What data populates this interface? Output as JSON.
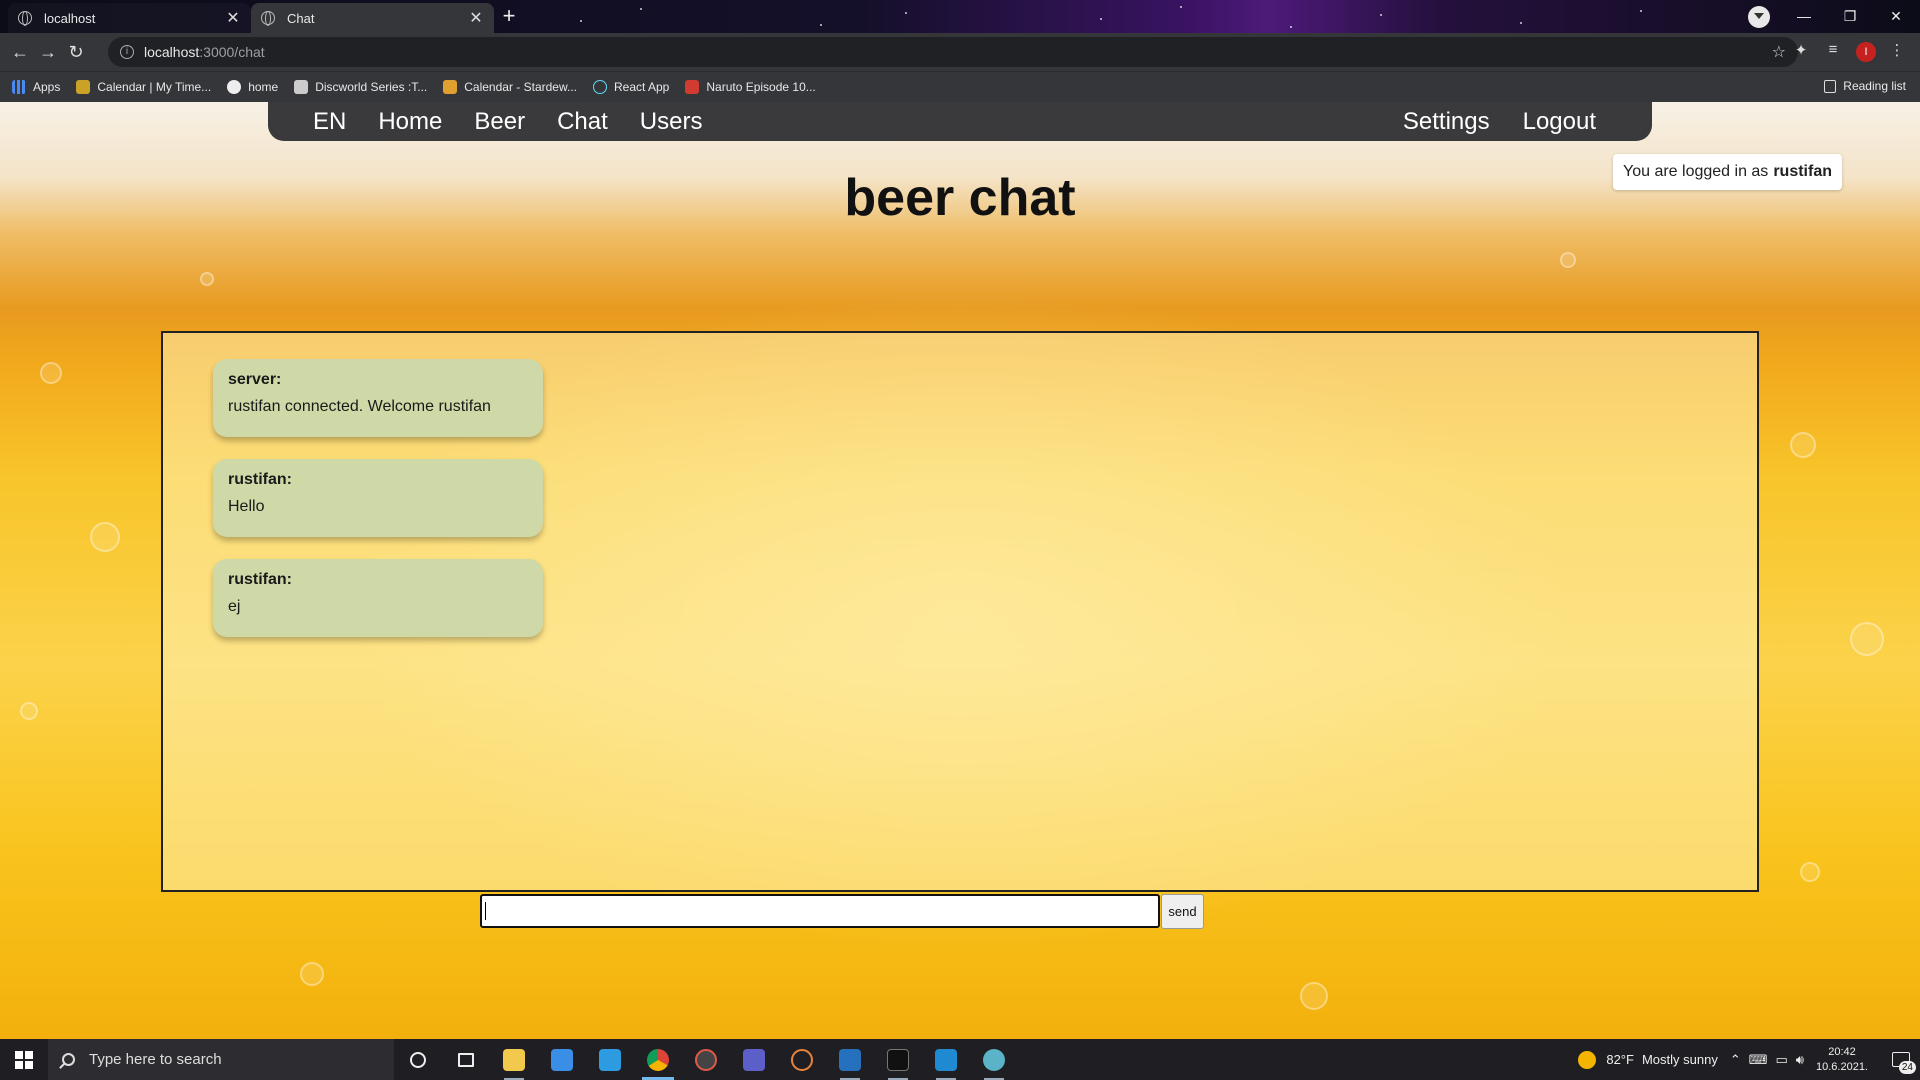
{
  "browser": {
    "tabs": [
      {
        "title": "localhost"
      },
      {
        "title": "Chat"
      }
    ],
    "url_host": "localhost",
    "url_path": ":3000/chat",
    "bookmarks": [
      {
        "label": "Apps"
      },
      {
        "label": "Calendar | My Time..."
      },
      {
        "label": "home"
      },
      {
        "label": "Discworld Series :T..."
      },
      {
        "label": "Calendar - Stardew..."
      },
      {
        "label": "React App"
      },
      {
        "label": "Naruto Episode 10..."
      }
    ],
    "reading_list": "Reading list",
    "profile_initial": "I"
  },
  "nav": {
    "lang": "EN",
    "home": "Home",
    "beer": "Beer",
    "chat": "Chat",
    "users": "Users",
    "settings": "Settings",
    "logout": "Logout"
  },
  "login_status": {
    "prefix": "You are logged in as",
    "username": "rustifan"
  },
  "page_title": "beer chat",
  "messages": [
    {
      "sender": "server:",
      "text": "rustifan connected. Welcome rustifan"
    },
    {
      "sender": "rustifan:",
      "text": "Hello"
    },
    {
      "sender": "rustifan:",
      "text": "ej"
    }
  ],
  "composer": {
    "value": "",
    "send_label": "send"
  },
  "taskbar": {
    "search_placeholder": "Type here to search",
    "weather_temp": "82°F",
    "weather_desc": "Mostly sunny",
    "time": "20:42",
    "date": "10.6.2021.",
    "notification_count": "24"
  },
  "colors": {
    "navbar_bg": "#3a3a3c",
    "message_bubble": "#cfd9a8",
    "beer_gold": "#f8c52a"
  }
}
